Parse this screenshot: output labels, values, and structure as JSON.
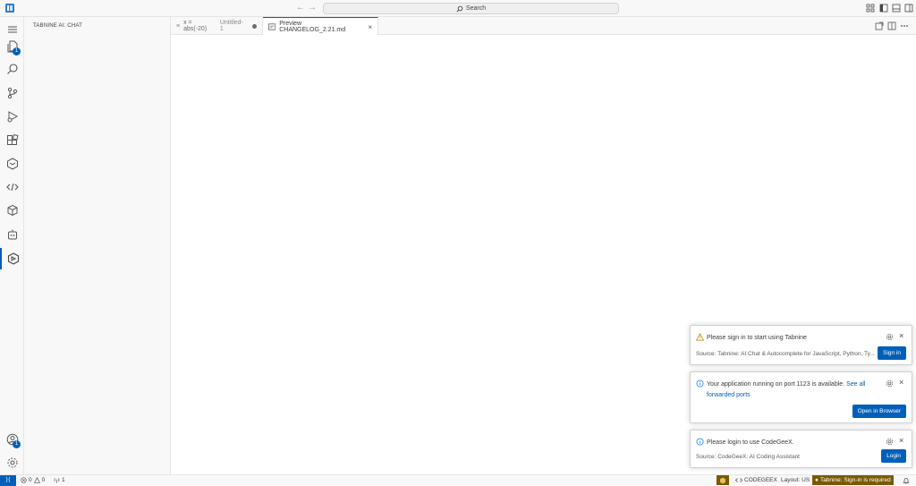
{
  "titlebar": {
    "search_label": "Search",
    "back_icon": "arrow-left-icon",
    "forward_icon": "arrow-right-icon"
  },
  "activitybar": {
    "explorer_badge": "1",
    "accounts_badge": "1"
  },
  "sidebar": {
    "title": "TABNINE AI: CHAT"
  },
  "tabs": [
    {
      "prefix": "≡",
      "label": "x = abs(-20)",
      "detail": "Untitled-1"
    },
    {
      "label": "Preview CHANGELOG_2.21.md"
    }
  ],
  "statusbar": {
    "remote_icon": "remote-icon",
    "errors": "0",
    "warnings": "0",
    "ports": "1",
    "codegeex": "CODEGEEX",
    "layout": "Layout: US",
    "tabnine": "Tabnine: Sign-in is required"
  },
  "notifications": [
    {
      "icon": "warning-icon",
      "message": "Please sign in to start using Tabnine",
      "source": "Source: Tabnine: AI Chat & Autocomplete for JavaScript, Python, Ty...",
      "button": "Sign in"
    },
    {
      "icon": "info-icon",
      "message": "Your application running on port 1123 is available.",
      "link": "See all forwarded ports",
      "button": "Open in Browser"
    },
    {
      "icon": "info-icon",
      "message": "Please login to use CodeGeeX.",
      "source": "Source: CodeGeeX: AI Coding Assistant",
      "button": "Login"
    }
  ],
  "colors": {
    "accent": "#005fb8",
    "tabnine_status": "#7a5a00",
    "warning": "#bf8803"
  }
}
